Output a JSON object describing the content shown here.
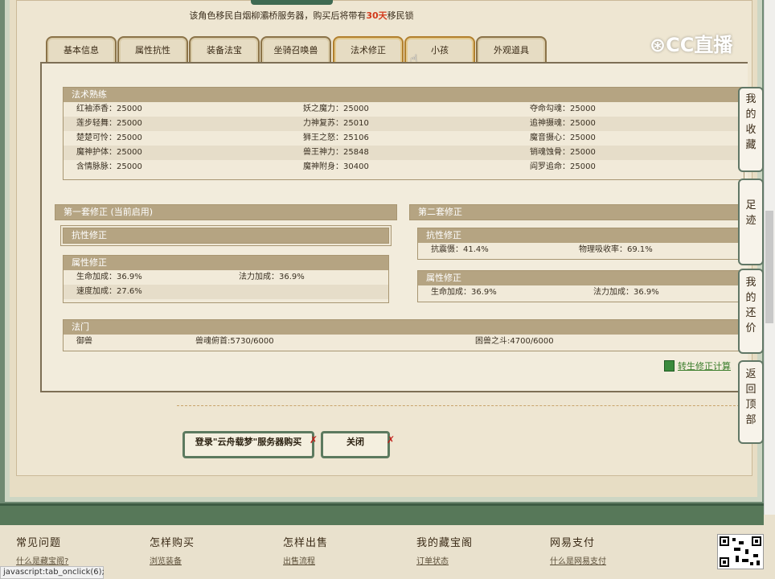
{
  "notice": {
    "before": "该角色移民自烟柳灞桥服务器，购买后将带有",
    "highlight": "30天",
    "after": "移民锁"
  },
  "tabs": [
    "基本信息",
    "属性抗性",
    "装备法宝",
    "坐骑召唤兽",
    "法术修正",
    "小孩",
    "外观道具"
  ],
  "skills": {
    "title": "法术熟练",
    "rows": [
      [
        "红袖添香：25000",
        "妖之魔力：25000",
        "夺命勾魂：25000"
      ],
      [
        "莲步轻舞：25000",
        "力神复苏：25010",
        "追神摄魂：25000"
      ],
      [
        "楚楚可怜：25000",
        "狮王之怒：25106",
        "魔音摄心：25000"
      ],
      [
        "魔神护体：25000",
        "兽王神力：25848",
        "销魂蚀骨：25000"
      ],
      [
        "含情脉脉：25000",
        "魔神附身：30400",
        "阎罗追命：25000"
      ]
    ]
  },
  "set1": {
    "title": "第一套修正 (当前启用)",
    "resist_title": "抗性修正",
    "attr_title": "属性修正",
    "attr_rows": [
      [
        "生命加成：36.9%",
        "法力加成：36.9%"
      ],
      [
        "速度加成：27.6%",
        ""
      ]
    ]
  },
  "set2": {
    "title": "第二套修正",
    "resist_title": "抗性修正",
    "resist_rows": [
      [
        "抗震慑：41.4%",
        "物理吸收率：69.1%"
      ]
    ],
    "attr_title": "属性修正",
    "attr_rows": [
      [
        "生命加成：36.9%",
        "法力加成：36.9%"
      ]
    ]
  },
  "school": {
    "title": "法门",
    "values": [
      "御兽",
      "兽魂俯首:5730/6000",
      "困兽之斗:4700/6000"
    ]
  },
  "calc_link": "转生修正计算",
  "buttons": {
    "buy": "登录\"云舟载梦\"服务器购买",
    "close": "关闭"
  },
  "side": [
    "我的收藏",
    "足迹",
    "我的还价",
    "返回顶部"
  ],
  "footer": {
    "cols": [
      {
        "title": "常见问题",
        "link": "什么是藏宝阁?"
      },
      {
        "title": "怎样购买",
        "link": "浏览装备"
      },
      {
        "title": "怎样出售",
        "link": "出售流程"
      },
      {
        "title": "我的藏宝阁",
        "link": "订单状态"
      },
      {
        "title": "网易支付",
        "link": "什么是网易支付"
      }
    ]
  },
  "status_text": "javascript:tab_onclick(6);",
  "watermark": "CC直播",
  "colors": {
    "accent_red": "#d23a1c",
    "frame_green": "#577859",
    "header_tan": "#b5a482"
  }
}
